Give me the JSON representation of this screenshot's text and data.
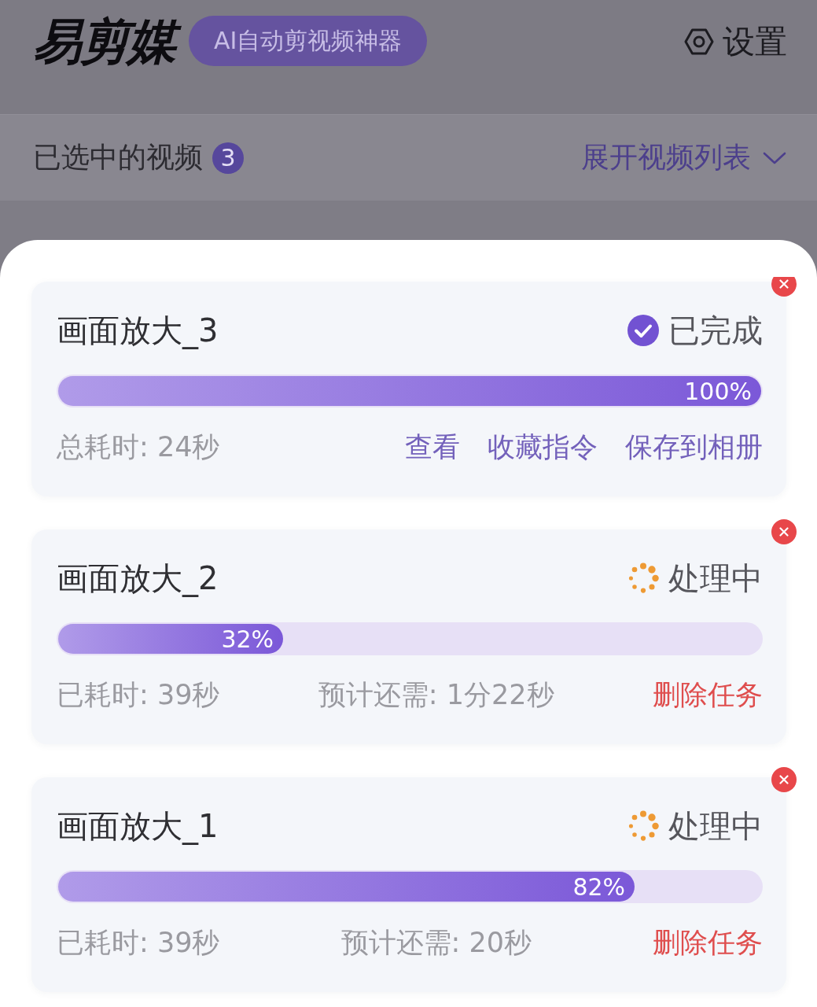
{
  "header": {
    "logo": "易剪媒",
    "tagline": "AI自动剪视频神器",
    "settings": "设置"
  },
  "selection_bar": {
    "label": "已选中的视频",
    "count": "3",
    "expand": "展开视频列表"
  },
  "tasks": [
    {
      "title": "画面放大_3",
      "status": {
        "kind": "done",
        "label": "已完成"
      },
      "level": 1,
      "percent": "100%",
      "elapsed": "总耗时: 24秒",
      "actions": [
        {
          "kind": "link",
          "label": "查看"
        },
        {
          "kind": "link",
          "label": "收藏指令"
        },
        {
          "kind": "link",
          "label": "保存到相册"
        }
      ]
    },
    {
      "title": "画面放大_2",
      "status": {
        "kind": "processing",
        "label": "处理中"
      },
      "level": 0.32,
      "percent": "32%",
      "elapsed": "已耗时: 39秒",
      "remaining": "预计还需: 1分22秒",
      "actions": [
        {
          "kind": "danger",
          "label": "删除任务"
        }
      ]
    },
    {
      "title": "画面放大_1",
      "status": {
        "kind": "processing",
        "label": "处理中"
      },
      "level": 0.82,
      "percent": "82%",
      "elapsed": "已耗时: 39秒",
      "remaining": "预计还需: 20秒",
      "actions": [
        {
          "kind": "danger",
          "label": "删除任务"
        }
      ]
    }
  ]
}
